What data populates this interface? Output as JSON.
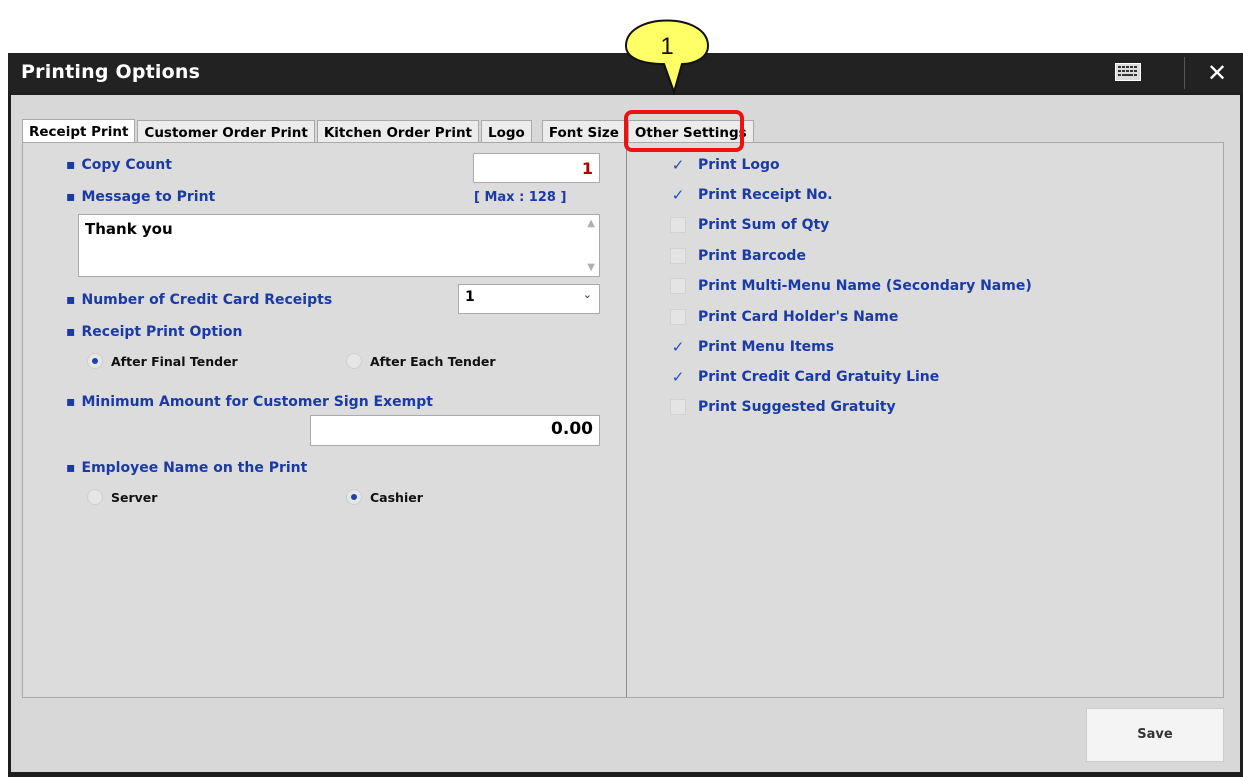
{
  "window": {
    "title": "Printing Options"
  },
  "tabs": [
    "Receipt Print",
    "Customer Order Print",
    "Kitchen Order Print",
    "Logo",
    "Font Size",
    "Other Settings"
  ],
  "left": {
    "bullet": "▪",
    "copy_count_label": "Copy Count",
    "copy_count_value": "1",
    "message_label": "Message to Print",
    "message_max": "[ Max : 128 ]",
    "message_value": "Thank you",
    "credit_receipts_label": "Number of Credit Card Receipts",
    "credit_receipts_value": "1",
    "receipt_option_label": "Receipt Print Option",
    "receipt_option_1": "After Final Tender",
    "receipt_option_2": "After Each Tender",
    "min_amount_label": "Minimum Amount for Customer Sign Exempt",
    "min_amount_value": "0.00",
    "employee_label": "Employee Name on the Print",
    "employee_option_1": "Server",
    "employee_option_2": "Cashier"
  },
  "right": {
    "options": [
      {
        "label": "Print Logo",
        "checked": true
      },
      {
        "label": "Print Receipt No.",
        "checked": true
      },
      {
        "label": "Print Sum of Qty",
        "checked": false
      },
      {
        "label": "Print Barcode",
        "checked": false
      },
      {
        "label": "Print Multi-Menu Name (Secondary Name)",
        "checked": false
      },
      {
        "label": "Print Card Holder's Name",
        "checked": false
      },
      {
        "label": "Print Menu Items",
        "checked": true
      },
      {
        "label": "Print Credit Card Gratuity Line",
        "checked": true
      },
      {
        "label": "Print Suggested Gratuity",
        "checked": false
      }
    ]
  },
  "buttons": {
    "save": "Save"
  },
  "callout": {
    "number": "1"
  },
  "icons": {
    "keyboard": "keyboard-icon",
    "close": "close-icon",
    "checkmark": "✓"
  },
  "colors": {
    "label_blue": "#1a3aa6",
    "callout_yellow": "#ffff66",
    "callout_red": "#ee1111",
    "copy_count_red": "#b00000"
  }
}
